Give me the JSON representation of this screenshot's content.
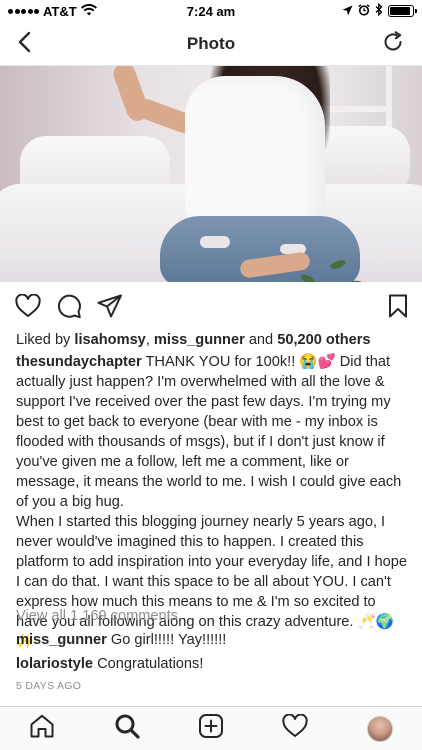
{
  "status_bar": {
    "carrier": "AT&T",
    "time": "7:24 am",
    "battery_level": 0.9
  },
  "nav": {
    "title": "Photo",
    "back_icon": "chevron-left-icon",
    "refresh_icon": "refresh-icon"
  },
  "post": {
    "likes": {
      "prefix": "Liked by ",
      "user1": "lisahomsy",
      "sep": ", ",
      "user2": "miss_gunner",
      "and": " and ",
      "count": "50,200 others"
    },
    "caption": {
      "username": "thesundaychapter",
      "paragraph1": " THANK YOU for 100k!! 😭💕 Did that actually just happen? I'm overwhelmed with all the love & support I've received over the past few days. I'm trying my best to get back to everyone (bear with me - my inbox is flooded with thousands of msgs), but if I don't just know if you've given me a follow, left me a comment, like or message, it means the world to me. I wish I could give each of you a big hug.",
      "paragraph2": "When I started this blogging journey nearly 5 years ago, I never would've imagined this to happen. I created this platform to add inspiration into your everyday life, and I hope I can do that.  I want this space to be all about YOU. I can't express how much this means to me & I'm so excited to have you all following along on this crazy adventure. 🥂🌍✨"
    },
    "view_all_comments": "View all 1,169 comments",
    "comments": [
      {
        "username": "miss_gunner",
        "text": " Go girl!!!!! Yay!!!!!!"
      },
      {
        "username": "lolariostyle",
        "text": " Congratulations!"
      }
    ],
    "date": "5 DAYS AGO"
  },
  "tab_bar": {
    "items": [
      "home-icon",
      "search-icon",
      "add-icon",
      "heart-icon",
      "profile-avatar"
    ]
  },
  "colors": {
    "text": "#262626",
    "muted": "#8e8e8e",
    "divider": "#dbdbdb"
  }
}
